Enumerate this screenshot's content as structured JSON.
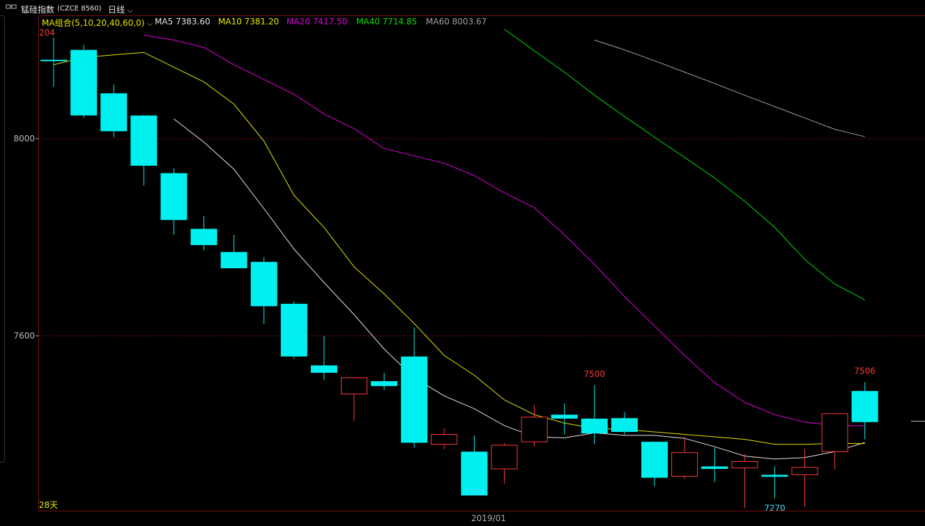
{
  "header": {
    "toggle_icon": "toggle-icon",
    "instrument": "锰硅指数",
    "code": "(CZCE 8560)",
    "period": "日线",
    "period_dropdown_icon": "chevron-down-icon"
  },
  "legend": {
    "group_label": "MA组合(5,10,20,40,60,0)",
    "group_dropdown_icon": "chevron-down-icon",
    "items": [
      {
        "label": "MA5 7383.60",
        "color": "#e6e6e6"
      },
      {
        "label": "MA10 7381.20",
        "color": "#e8e800"
      },
      {
        "label": "MA20 7417.50",
        "color": "#e000e0"
      },
      {
        "label": "MA40 7714.85",
        "color": "#00e000"
      },
      {
        "label": "MA60 8003.67",
        "color": "#a0a0a0"
      }
    ]
  },
  "labels": {
    "top_left_clipped": "204",
    "days": "28天",
    "x_axis": "2019/01"
  },
  "chart_data": {
    "type": "candlestick",
    "y_ticks": [
      8000,
      7600
    ],
    "ylim": [
      7235,
      8225
    ],
    "colors": {
      "up": "#ff3b3b",
      "down": "#00f0f0",
      "grid": "#7a1010",
      "axis_text": "#bbbbbb"
    },
    "candles": [
      {
        "o": 8160,
        "h": 8205,
        "l": 8105,
        "c": 8160
      },
      {
        "o": 8180,
        "h": 8190,
        "l": 8042,
        "c": 8047
      },
      {
        "o": 8092,
        "h": 8110,
        "l": 8003,
        "c": 8015
      },
      {
        "o": 8047,
        "h": 8048,
        "l": 7905,
        "c": 7945
      },
      {
        "o": 7930,
        "h": 7940,
        "l": 7805,
        "c": 7835
      },
      {
        "o": 7385,
        "h": 7420,
        "l": 7357,
        "c": 7385
      },
      {
        "o": 7770,
        "h": 7805,
        "l": 7738,
        "c": 7737
      },
      {
        "o": 7750,
        "h": 7760,
        "l": 7624,
        "c": 7660
      },
      {
        "o": 7665,
        "h": 7670,
        "l": 7553,
        "c": 7558
      },
      {
        "o": 7540,
        "h": 7600,
        "l": 7510,
        "c": 7525
      },
      {
        "o": 7482,
        "h": 7505,
        "l": 7427,
        "c": 7515
      },
      {
        "o": 7508,
        "h": 7525,
        "l": 7490,
        "c": 7498
      },
      {
        "o": 7558,
        "h": 7617,
        "l": 7373,
        "c": 7383
      },
      {
        "o": 7380,
        "h": 7412,
        "l": 7370,
        "c": 7400
      },
      {
        "o": 7365,
        "h": 7398,
        "l": 7302,
        "c": 7276
      },
      {
        "o": 7330,
        "h": 7382,
        "l": 7300,
        "c": 7378
      },
      {
        "o": 7385,
        "h": 7460,
        "l": 7375,
        "c": 7435
      },
      {
        "o": 7440,
        "h": 7463,
        "l": 7400,
        "c": 7432
      },
      {
        "o": 7432,
        "h": 7500,
        "l": 7380,
        "c": 7402
      },
      {
        "o": 7433,
        "h": 7445,
        "l": 7400,
        "c": 7405
      },
      {
        "o": 7385,
        "h": 7385,
        "l": 7295,
        "c": 7312
      },
      {
        "o": 7315,
        "h": 7395,
        "l": 7310,
        "c": 7363
      },
      {
        "o": 7335,
        "h": 7373,
        "l": 7303,
        "c": 7330
      },
      {
        "o": 7332,
        "h": 7360,
        "l": 7250,
        "c": 7345
      },
      {
        "o": 7318,
        "h": 7335,
        "l": 7270,
        "c": 7314
      },
      {
        "o": 7318,
        "h": 7370,
        "l": 7253,
        "c": 7333
      },
      {
        "o": 7365,
        "h": 7443,
        "l": 7330,
        "c": 7442
      },
      {
        "o": 7488,
        "h": 7506,
        "l": 7390,
        "c": 7425
      }
    ],
    "candle_overrides": [
      {
        "index": 5,
        "o": 7817,
        "h": 7843,
        "l": 7773,
        "c": 7784
      }
    ],
    "ma_series": [
      {
        "name": "MA5",
        "color": "#e6e6e6",
        "values": [
          null,
          null,
          null,
          null,
          8040,
          7993,
          7938,
          7858,
          7776,
          7708,
          7643,
          7573,
          7515,
          7478,
          7452,
          7418,
          7395,
          7393,
          7403,
          7398,
          7398,
          7392,
          7375,
          7356,
          7350,
          7353,
          7365,
          7383.6
        ]
      },
      {
        "name": "MA10",
        "color": "#e8e800",
        "values": [
          8150,
          8165,
          8170,
          8175,
          8145,
          8115,
          8070,
          7995,
          7885,
          7820,
          7740,
          7685,
          7625,
          7560,
          7520,
          7470,
          7440,
          7423,
          7412,
          7410,
          7405,
          7400,
          7395,
          7390,
          7380,
          7380,
          7382,
          7381.2
        ]
      },
      {
        "name": "MA20",
        "color": "#e000e0",
        "values": [
          8210,
          8200,
          8185,
          8150,
          8120,
          8090,
          8050,
          8020,
          7980,
          7965,
          7950,
          7925,
          7890,
          7860,
          7805,
          7745,
          7680,
          7620,
          7560,
          7505,
          7465,
          7440,
          7425,
          7418,
          7417.5
        ]
      },
      {
        "name": "MA40",
        "color": "#00e000",
        "values": [
          8222,
          8178,
          8135,
          8088,
          8045,
          8003,
          7962,
          7920,
          7873,
          7820,
          7755,
          7705,
          7673
        ]
      },
      {
        "name": "MA60",
        "color": "#a0a0a0",
        "values": [
          8200,
          8180,
          8158,
          8135,
          8112,
          8088,
          8065,
          8042,
          8019,
          8004
        ]
      }
    ],
    "annotations": [
      {
        "text": "7500",
        "index": 18,
        "value": 7500,
        "color": "#ff3b3b"
      },
      {
        "text": "7302",
        "index": 14,
        "value": 7302,
        "color": "#40e0ff"
      },
      {
        "text": "7270",
        "index": 24,
        "value": 7270,
        "color": "#40e0ff"
      },
      {
        "text": "7506",
        "index": 27,
        "value": 7506,
        "color": "#ff3b3b"
      }
    ]
  }
}
